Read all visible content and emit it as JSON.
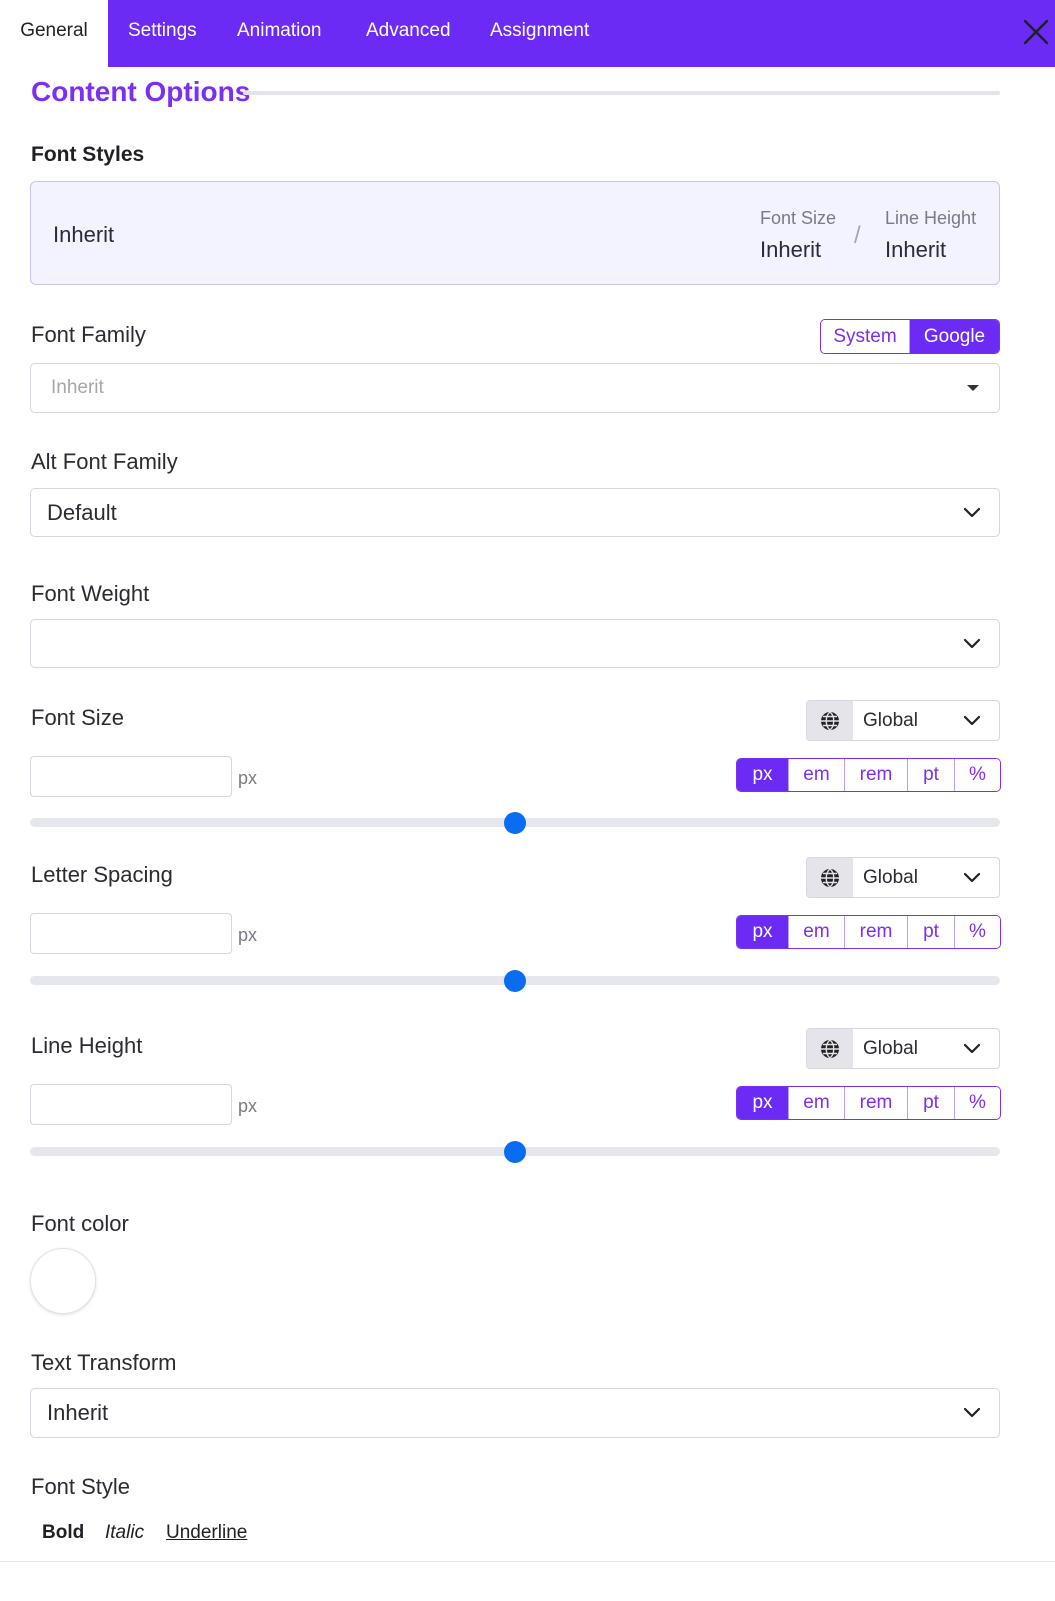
{
  "tabs": [
    {
      "label": "General",
      "active": true
    },
    {
      "label": "Settings",
      "active": false
    },
    {
      "label": "Animation",
      "active": false
    },
    {
      "label": "Advanced",
      "active": false
    },
    {
      "label": "Assignment",
      "active": false
    }
  ],
  "close_icon": "close-icon",
  "section": {
    "title": "Content Options"
  },
  "font_styles": {
    "heading": "Font Styles",
    "preview_value": "Inherit",
    "font_size_label": "Font Size",
    "font_size_value": "Inherit",
    "separator": "/",
    "line_height_label": "Line Height",
    "line_height_value": "Inherit"
  },
  "font_family": {
    "label": "Font Family",
    "toggle": [
      {
        "label": "System",
        "active": false
      },
      {
        "label": "Google",
        "active": true
      }
    ],
    "placeholder": "Inherit"
  },
  "alt_font_family": {
    "label": "Alt Font Family",
    "value": "Default"
  },
  "font_weight": {
    "label": "Font Weight",
    "value": ""
  },
  "font_size": {
    "label": "Font Size",
    "scope": "Global",
    "value": "",
    "unit_label": "px",
    "units": [
      {
        "label": "px",
        "active": true
      },
      {
        "label": "em",
        "active": false
      },
      {
        "label": "rem",
        "active": false
      },
      {
        "label": "pt",
        "active": false
      },
      {
        "label": "%",
        "active": false
      }
    ],
    "slider_fraction": 0.5
  },
  "letter_spacing": {
    "label": "Letter Spacing",
    "scope": "Global",
    "value": "",
    "unit_label": "px",
    "units": [
      {
        "label": "px",
        "active": true
      },
      {
        "label": "em",
        "active": false
      },
      {
        "label": "rem",
        "active": false
      },
      {
        "label": "pt",
        "active": false
      },
      {
        "label": "%",
        "active": false
      }
    ],
    "slider_fraction": 0.5
  },
  "line_height": {
    "label": "Line Height",
    "scope": "Global",
    "value": "",
    "unit_label": "px",
    "units": [
      {
        "label": "px",
        "active": true
      },
      {
        "label": "em",
        "active": false
      },
      {
        "label": "rem",
        "active": false
      },
      {
        "label": "pt",
        "active": false
      },
      {
        "label": "%",
        "active": false
      }
    ],
    "slider_fraction": 0.5
  },
  "font_color": {
    "label": "Font color",
    "value": "#ffffff"
  },
  "text_transform": {
    "label": "Text Transform",
    "value": "Inherit"
  },
  "font_style": {
    "label": "Font Style",
    "options": [
      "Bold",
      "Italic",
      "Underline"
    ]
  },
  "colors": {
    "accent": "#6c2bf5",
    "accent_text": "#7b2ff2",
    "slider_thumb": "#0a6cf0",
    "preview_bg": "#f3f2ff"
  },
  "icons": {
    "globe": "globe-icon",
    "chevron": "chevron-down-icon",
    "caret": "caret-down-icon"
  }
}
